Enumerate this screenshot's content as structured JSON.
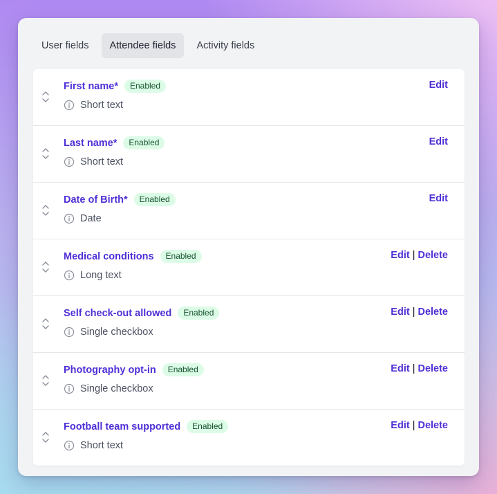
{
  "tabs": [
    {
      "label": "User fields"
    },
    {
      "label": "Attendee fields"
    },
    {
      "label": "Activity fields"
    }
  ],
  "active_tab": "Attendee fields",
  "separator": "|",
  "colors": {
    "accent": "#4f2fd6",
    "badge_bg": "#dcfce7",
    "badge_text": "#14532d"
  },
  "fields": [
    {
      "name": "First name*",
      "status": "Enabled",
      "type": "Short text",
      "edit": "Edit"
    },
    {
      "name": "Last name*",
      "status": "Enabled",
      "type": "Short text",
      "edit": "Edit"
    },
    {
      "name": "Date of Birth*",
      "status": "Enabled",
      "type": "Date",
      "edit": "Edit"
    },
    {
      "name": "Medical conditions",
      "status": "Enabled",
      "type": "Long text",
      "edit": "Edit",
      "delete": "Delete"
    },
    {
      "name": "Self check-out allowed",
      "status": "Enabled",
      "type": "Single checkbox",
      "edit": "Edit",
      "delete": "Delete"
    },
    {
      "name": "Photography opt-in",
      "status": "Enabled",
      "type": "Single checkbox",
      "edit": "Edit",
      "delete": "Delete"
    },
    {
      "name": "Football team supported",
      "status": "Enabled",
      "type": "Short text",
      "edit": "Edit",
      "delete": "Delete"
    }
  ]
}
